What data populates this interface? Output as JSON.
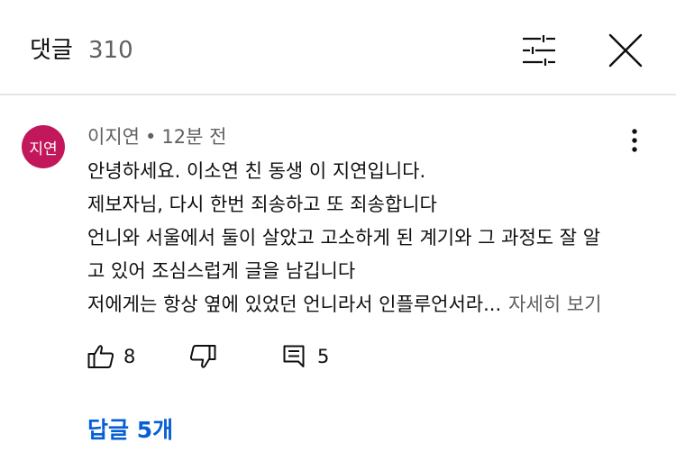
{
  "header": {
    "title": "댓글",
    "count": "310"
  },
  "icons": {
    "filter": "sliders-icon",
    "close": "close-icon",
    "more": "more-vertical-icon",
    "like": "thumbs-up-icon",
    "dislike": "thumbs-down-icon",
    "reply": "comment-icon"
  },
  "comment": {
    "avatar_text": "지연",
    "avatar_color": "#c2185b",
    "author": "이지연",
    "separator": "•",
    "time": "12분 전",
    "lines": [
      "안녕하세요. 이소연 친 동생 이 지연입니다.",
      "제보자님, 다시 한번 죄송하고 또 죄송합니다",
      "언니와 서울에서 둘이 살았고 고소하게 된 계기와 그 과정도 잘 알",
      "고 있어 조심스럽게 글을 남깁니다",
      "저에게는 항상 옆에 있었던 언니라서 인플루언서라..."
    ],
    "read_more": "자세히 보기",
    "like_count": "8",
    "reply_count": "5",
    "replies_link": "답글 5개"
  },
  "colors": {
    "link": "#065fd4",
    "secondary_text": "#606060",
    "primary_text": "#0f0f0f"
  }
}
